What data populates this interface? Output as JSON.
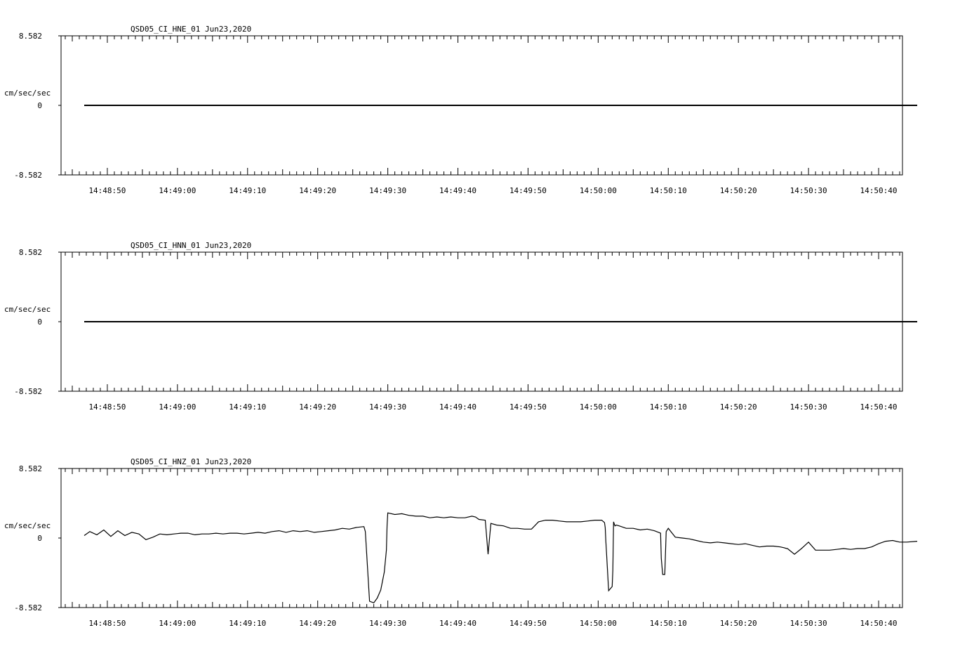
{
  "chart_data": [
    {
      "type": "line",
      "title": "QSD05_CI_HNE_01  Jun23,2020",
      "ylabel": "cm/sec/sec",
      "ylim": [
        -8.582,
        8.582
      ],
      "ytick_labels": [
        "8.582",
        "0",
        "-8.582"
      ],
      "x_tick_labels": [
        "14:48:50",
        "14:49:00",
        "14:49:10",
        "14:49:20",
        "14:49:30",
        "14:49:40",
        "14:49:50",
        "14:50:00",
        "14:50:10",
        "14:50:20",
        "14:50:30",
        "14:50:40"
      ],
      "x_start_s": 46.7,
      "x_end_s": 165.5,
      "series": [
        {
          "t": [
            46.7,
            165.5
          ],
          "values": [
            0,
            0
          ]
        }
      ]
    },
    {
      "type": "line",
      "title": "QSD05_CI_HNN_01  Jun23,2020",
      "ylabel": "cm/sec/sec",
      "ylim": [
        -8.582,
        8.582
      ],
      "ytick_labels": [
        "8.582",
        "0",
        "-8.582"
      ],
      "x_tick_labels": [
        "14:48:50",
        "14:49:00",
        "14:49:10",
        "14:49:20",
        "14:49:30",
        "14:49:40",
        "14:49:50",
        "14:50:00",
        "14:50:10",
        "14:50:20",
        "14:50:30",
        "14:50:40"
      ],
      "x_start_s": 46.7,
      "x_end_s": 165.5,
      "series": [
        {
          "t": [
            46.7,
            165.5
          ],
          "values": [
            0,
            0
          ]
        }
      ]
    },
    {
      "type": "line",
      "title": "QSD05_CI_HNZ_01  Jun23,2020",
      "ylabel": "cm/sec/sec",
      "ylim": [
        -8.582,
        8.582
      ],
      "ytick_labels": [
        "8.582",
        "0",
        "-8.582"
      ],
      "x_tick_labels": [
        "14:48:50",
        "14:49:00",
        "14:49:10",
        "14:49:20",
        "14:49:30",
        "14:49:40",
        "14:49:50",
        "14:50:00",
        "14:50:10",
        "14:50:20",
        "14:50:30",
        "14:50:40"
      ],
      "x_start_s": 46.7,
      "x_end_s": 165.5,
      "series": [
        {
          "t": [
            46.7,
            47.5,
            48.5,
            49.5,
            50.5,
            51.5,
            52.5,
            53.5,
            54.5,
            55.5,
            56.5,
            57.5,
            58.5,
            59.5,
            60.5,
            61.5,
            62.5,
            63.5,
            64.5,
            65.5,
            66.5,
            67.5,
            68.5,
            69.5,
            70.5,
            71.5,
            72.5,
            73.5,
            74.5,
            75.5,
            76.5,
            77.5,
            78.5,
            79.5,
            80.5,
            81.5,
            82.5,
            83.5,
            84.5,
            85.5,
            86.5,
            86.6,
            86.8,
            87.4,
            88.0,
            88.5,
            89.0,
            89.5,
            89.8,
            89.9,
            90.0,
            91.0,
            92.0,
            93.0,
            94.0,
            95.0,
            96.0,
            97.0,
            98.0,
            99.0,
            100.0,
            101.0,
            102.0,
            102.5,
            103.0,
            103.9,
            104.3,
            104.7,
            105.5,
            106.5,
            107.5,
            108.5,
            109.5,
            110.5,
            111.5,
            112.5,
            113.5,
            114.5,
            115.5,
            116.5,
            117.5,
            118.5,
            119.5,
            120.5,
            120.9,
            121.0,
            121.1,
            121.5,
            122.0,
            122.1,
            122.2,
            122.4,
            122.6,
            123.0,
            124.0,
            125.0,
            126.0,
            127.0,
            128.0,
            128.9,
            129.0,
            129.2,
            129.5,
            129.7,
            130.0,
            131.0,
            132.0,
            133.0,
            134.0,
            135.0,
            136.0,
            137.0,
            138.0,
            139.0,
            140.0,
            141.0,
            142.0,
            143.0,
            144.0,
            145.0,
            146.0,
            146.5,
            146.9,
            147.0,
            148.0,
            149.0,
            150.0,
            151.0,
            152.0,
            153.0,
            154.0,
            155.0,
            156.0,
            157.0,
            158.0,
            159.0,
            160.0,
            161.0,
            162.0,
            163.0,
            164.0,
            165.5
          ],
          "values": [
            0.3,
            0.8,
            0.4,
            1.0,
            0.2,
            0.9,
            0.3,
            0.7,
            0.5,
            -0.2,
            0.1,
            0.5,
            0.4,
            0.5,
            0.6,
            0.6,
            0.4,
            0.5,
            0.5,
            0.6,
            0.5,
            0.6,
            0.6,
            0.5,
            0.6,
            0.7,
            0.6,
            0.8,
            0.9,
            0.7,
            0.9,
            0.8,
            0.9,
            0.7,
            0.8,
            0.9,
            1.0,
            1.2,
            1.1,
            1.3,
            1.4,
            1.4,
            0.8,
            -7.8,
            -8.0,
            -7.4,
            -6.4,
            -4.2,
            -1.5,
            1.6,
            3.1,
            2.9,
            3.0,
            2.8,
            2.7,
            2.7,
            2.5,
            2.6,
            2.5,
            2.6,
            2.5,
            2.5,
            2.7,
            2.6,
            2.3,
            2.2,
            -2.0,
            1.8,
            1.6,
            1.5,
            1.2,
            1.2,
            1.1,
            1.1,
            2.0,
            2.2,
            2.2,
            2.1,
            2.0,
            2.0,
            2.0,
            2.1,
            2.2,
            2.2,
            1.9,
            1.3,
            -0.5,
            -6.5,
            -6.0,
            -4.0,
            2.0,
            1.5,
            1.6,
            1.5,
            1.2,
            1.2,
            1.0,
            1.1,
            0.9,
            0.6,
            -2.5,
            -4.5,
            -4.5,
            0.8,
            1.2,
            0.1,
            0.0,
            -0.1,
            -0.3,
            -0.5,
            -0.6,
            -0.5,
            -0.6,
            -0.7,
            -0.8,
            -0.7,
            -0.9,
            -1.1,
            -1.0,
            -1.0,
            -1.1,
            -1.2,
            -1.3,
            -1.3,
            -2.0,
            -1.3,
            -0.5,
            -1.5,
            -1.5,
            -1.5,
            -1.4,
            -1.3,
            -1.4,
            -1.3,
            -1.3,
            -1.1,
            -0.7,
            -0.4,
            -0.3,
            -0.5,
            -0.5,
            -0.4,
            -0.3,
            -0.4,
            -0.2,
            -0.1
          ]
        }
      ]
    }
  ]
}
